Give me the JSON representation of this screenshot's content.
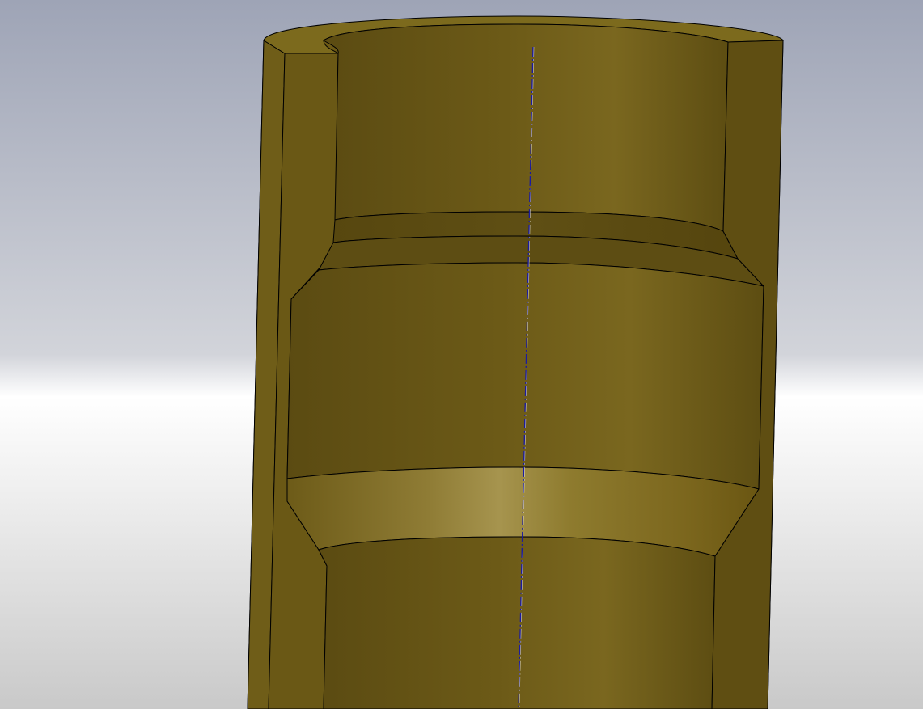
{
  "viewport": {
    "background_top": "#a2a8ba",
    "background_mid": "#ffffff",
    "background_bottom": "#cfcfcf"
  },
  "model": {
    "part_color": "#7d6a1c",
    "part_shadow": "#5e4f12",
    "part_highlight": "#a89450",
    "edge_color": "#000000",
    "centerline_color": "#1a1aa0"
  }
}
